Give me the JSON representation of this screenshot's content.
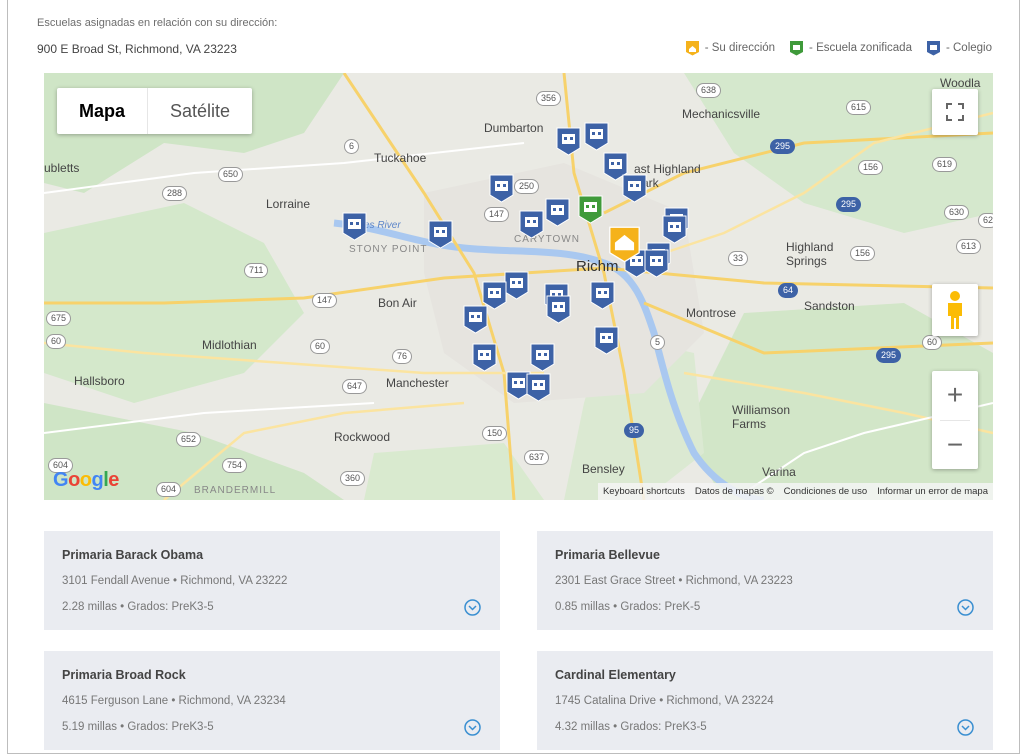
{
  "header": {
    "intro": "Escuelas asignadas en relación con su dirección:",
    "address": "900 E Broad St, Richmond, VA 23223"
  },
  "legend": [
    {
      "icon": "home-icon",
      "label": "- Su dirección",
      "color": "#f5b21b"
    },
    {
      "icon": "zoned-school-icon",
      "label": "- Escuela zonificada",
      "color": "#3f9a3a"
    },
    {
      "icon": "school-icon",
      "label": "- Colegio",
      "color": "#3d62a6"
    }
  ],
  "map": {
    "map_type_map": "Mapa",
    "map_type_satellite": "Satélite",
    "zoom_in": "+",
    "zoom_out": "−",
    "google_logo": "Google",
    "attribution": {
      "shortcuts": "Keyboard shortcuts",
      "data": "Datos de mapas ©",
      "terms": "Condiciones de uso",
      "report": "Informar un error de mapa"
    },
    "places": {
      "dumbarton": "Dumbarton",
      "mechanicsville": "Mechanicsville",
      "tuckahoe": "Tuckahoe",
      "east_highland_park": "ast Highland\nPark",
      "lorraine": "Lorraine",
      "richmond": "Richm",
      "highland_springs": "Highland\nSprings",
      "bon_air": "Bon Air",
      "montrose": "Montrose",
      "sandston": "Sandston",
      "midlothian": "Midlothian",
      "hallsboro": "Hallsboro",
      "manchester": "Manchester",
      "williamson_farms": "Williamson\nFarms",
      "rockwood": "Rockwood",
      "bensley": "Bensley",
      "varina": "Varina",
      "brandermill": "BRANDERMILL",
      "stony_point": "STONY POINT",
      "carytown": "CARYTOWN",
      "ubletts": "ubletts",
      "woodla": "Woodla",
      "james_river": "es River"
    },
    "shields": [
      "356",
      "638",
      "615",
      "6",
      "295",
      "619",
      "650",
      "156",
      "250",
      "288",
      "147",
      "295",
      "630",
      "62",
      "613",
      "711",
      "33",
      "156",
      "147",
      "64",
      "675",
      "60",
      "60",
      "5",
      "76",
      "295",
      "60",
      "647",
      "652",
      "150",
      "637",
      "754",
      "604",
      "604",
      "360",
      "95"
    ]
  },
  "schools": [
    {
      "name": "Primaria Barack Obama",
      "address": "3101 Fendall Avenue • Richmond, VA 23222",
      "details": "2.28 millas • Grados: PreK3-5"
    },
    {
      "name": "Primaria Bellevue",
      "address": "2301 East Grace Street • Richmond, VA 23223",
      "details": "0.85 millas • Grados: PreK-5"
    },
    {
      "name": "Primaria Broad Rock",
      "address": "4615 Ferguson Lane • Richmond, VA 23234",
      "details": "5.19 millas • Grados: PreK3-5"
    },
    {
      "name": "Cardinal Elementary",
      "address": "1745 Catalina Drive • Richmond, VA 23224",
      "details": "4.32 millas • Grados: PreK3-5"
    }
  ]
}
